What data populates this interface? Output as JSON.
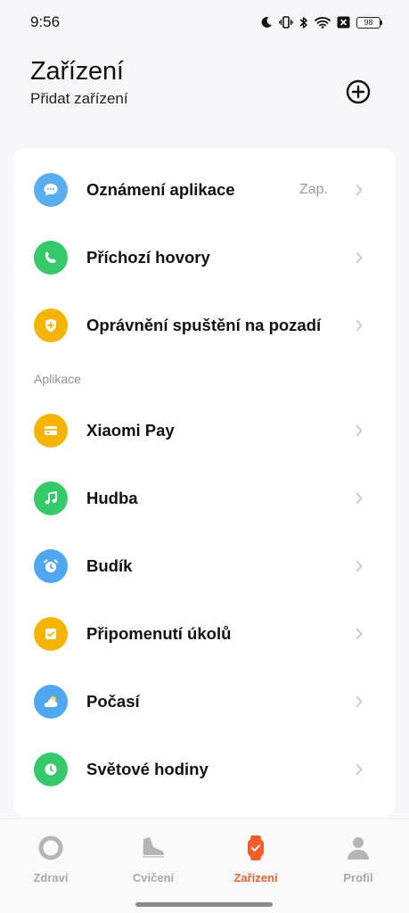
{
  "status_bar": {
    "time": "9:56",
    "battery": "98"
  },
  "header": {
    "title": "Zařízení",
    "subtitle": "Přidat zařízení"
  },
  "settings": {
    "section_label": "Aplikace",
    "items": [
      {
        "label": "Oznámení aplikace",
        "value": "Zap.",
        "icon": "chat-bubble-icon",
        "color": "#5aaef0"
      },
      {
        "label": "Příchozí hovory",
        "value": "",
        "icon": "phone-icon",
        "color": "#35c96a"
      },
      {
        "label": "Oprávnění spuštění na pozadí",
        "value": "",
        "icon": "shield-icon",
        "color": "#f5b400"
      },
      {
        "label": "Xiaomi Pay",
        "value": "",
        "icon": "card-icon",
        "color": "#f5b400"
      },
      {
        "label": "Hudba",
        "value": "",
        "icon": "music-note-icon",
        "color": "#35c96a"
      },
      {
        "label": "Budík",
        "value": "",
        "icon": "alarm-clock-icon",
        "color": "#4fa8ef"
      },
      {
        "label": "Připomenutí úkolů",
        "value": "",
        "icon": "task-check-icon",
        "color": "#f5b400"
      },
      {
        "label": "Počasí",
        "value": "",
        "icon": "weather-icon",
        "color": "#4fa8ef"
      },
      {
        "label": "Světové hodiny",
        "value": "",
        "icon": "world-clock-icon",
        "color": "#35c96a"
      }
    ]
  },
  "bottom_nav": {
    "active_color": "#f25d2b",
    "tabs": [
      {
        "label": "Zdraví",
        "icon": "health-ring-icon"
      },
      {
        "label": "Cvičení",
        "icon": "shoe-icon"
      },
      {
        "label": "Zařízení",
        "icon": "watch-icon",
        "active": true
      },
      {
        "label": "Profil",
        "icon": "person-icon"
      }
    ]
  }
}
